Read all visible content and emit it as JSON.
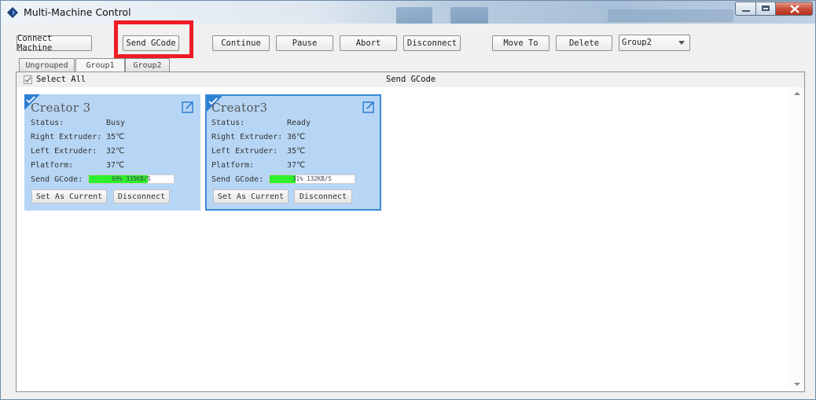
{
  "window": {
    "title": "Multi-Machine Control"
  },
  "toolbar": {
    "connect": "Connect Machine",
    "send_gcode": "Send GCode",
    "continue": "Continue",
    "pause": "Pause",
    "abort": "Abort",
    "disconnect": "Disconnect",
    "move_to": "Move To",
    "delete": "Delete",
    "group_select": "Group2"
  },
  "tabs": [
    {
      "label": "Ungrouped"
    },
    {
      "label": "Group1",
      "selected": true
    },
    {
      "label": "Group2"
    }
  ],
  "panel": {
    "select_all": "Select All",
    "column_title": "Send GCode"
  },
  "machines": [
    {
      "name": "Creator 3",
      "status_label": "Status:",
      "status": "Busy",
      "right_label": "Right Extruder:",
      "right": "35℃",
      "left_label": "Left Extruder:",
      "left": "32℃",
      "platform_label": "Platform:",
      "platform": "37℃",
      "send_label": "Send GCode:",
      "progress_text": "69% 335KB/S",
      "progress": 0.69,
      "set_current": "Set As Current",
      "disconnect": "Disconnect"
    },
    {
      "name": "Creator3",
      "status_label": "Status:",
      "status": "Ready",
      "right_label": "Right Extruder:",
      "right": "36℃",
      "left_label": "Left Extruder:",
      "left": "35℃",
      "platform_label": "Platform:",
      "platform": "37℃",
      "send_label": "Send GCode:",
      "progress_text": "31% 132KB/S",
      "progress": 0.31,
      "set_current": "Set As Current",
      "disconnect": "Disconnect"
    }
  ],
  "colors": {
    "card_bg": "#b7d6f5",
    "card_border": "#3d8ad6",
    "progress_fill": "#2ef02e",
    "highlight": "#ee1c25"
  }
}
